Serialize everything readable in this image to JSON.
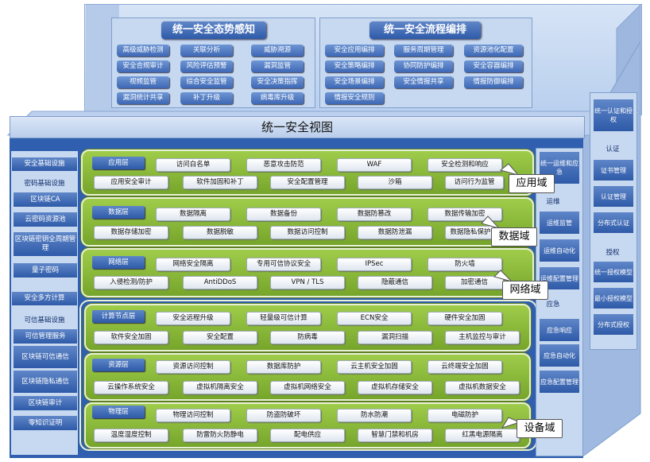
{
  "situational": {
    "title": "统一安全态势感知",
    "items": [
      "高级威胁检测",
      "关联分析",
      "威胁溯源",
      "安全合规审计",
      "风险评估预警",
      "漏洞监管",
      "视频监管",
      "综合安全监管",
      "安全决策指挥",
      "漏洞统计共享",
      "补丁升级",
      "病毒库升级"
    ]
  },
  "process": {
    "title": "统一安全流程编排",
    "items": [
      "安全应用编排",
      "服务周期管理",
      "资源池化配置",
      "安全策略编排",
      "协同防护编排",
      "安全容器编排",
      "安全场景编排",
      "安全情报共享",
      "情报防御编排",
      "情报安全规则"
    ]
  },
  "view_title": "统一安全视图",
  "left": {
    "sec1": "安全基础设施",
    "plain1": "密码基础设施",
    "items1": [
      "区块链CA",
      "云密码资源池",
      "区块链密钥全周期管理",
      "量子密码"
    ],
    "sec2": "安全多方计算",
    "plain2": "可信基础设施",
    "items2": [
      "可信管理服务",
      "区块链可信通信",
      "区块链隐私通信",
      "区块链审计",
      "零知识证明"
    ]
  },
  "layers": {
    "app": {
      "title": "应用层",
      "row1": [
        "访问白名单",
        "恶意攻击防范",
        "WAF",
        "安全检测和响应"
      ],
      "row2": [
        "应用安全审计",
        "软件加固和补丁",
        "安全配置管理",
        "沙箱",
        "访问行为监管"
      ]
    },
    "data": {
      "title": "数据层",
      "row1": [
        "数据隔离",
        "数据备份",
        "数据防篡改",
        "数据传输加密"
      ],
      "row2": [
        "数据存储加密",
        "数据脱敏",
        "数据访问控制",
        "数据防泄漏",
        "数据隐私保护"
      ]
    },
    "net": {
      "title": "网络层",
      "row1": [
        "网络安全隔离",
        "专用可信协议安全",
        "IPSec",
        "防火墙"
      ],
      "row2": [
        "入侵检测/防护",
        "AntiDDoS",
        "VPN / TLS",
        "隐蔽通信",
        "加密通信"
      ]
    },
    "node": {
      "title": "计算节点层",
      "row1": [
        "安全远程升级",
        "轻量级可信计算",
        "ECN安全",
        "硬件安全加固"
      ],
      "row2": [
        "软件安全加固",
        "安全配置",
        "防病毒",
        "漏洞扫描",
        "主机监控与审计"
      ]
    },
    "res": {
      "title": "资源层",
      "row1": [
        "资源访问控制",
        "数据库防护",
        "云主机安全加固",
        "云终端安全加固"
      ],
      "row2": [
        "云操作系统安全",
        "虚拟机隔离安全",
        "虚拟机网络安全",
        "虚拟机存储安全",
        "虚拟机数据安全"
      ]
    },
    "phy": {
      "title": "物理层",
      "row1": [
        "物理访问控制",
        "防盗防破坏",
        "防水防潮",
        "电磁防护"
      ],
      "row2": [
        "温度湿度控制",
        "防雷防火防静电",
        "配电供应",
        "智慧门禁和机房",
        "红黑电源隔离"
      ]
    }
  },
  "callouts": [
    "应用域",
    "数据域",
    "网络域",
    "设备域"
  ],
  "ops": {
    "top": "统一运维和应急",
    "sec_ops": "运维",
    "ops_items": [
      "运维监管",
      "运维自动化",
      "运维配置管理"
    ],
    "sec_emg": "应急",
    "emg_items": [
      "应急响应",
      "应急自动化",
      "应急配置管理"
    ]
  },
  "auth": {
    "top": "统一认证和授权",
    "sec_authn": "认证",
    "authn_items": [
      "证书管理",
      "认证管理",
      "分布式认证"
    ],
    "sec_authz": "授权",
    "authz_items": [
      "统一授权模型",
      "最小授权模型",
      "分布式授权"
    ]
  }
}
